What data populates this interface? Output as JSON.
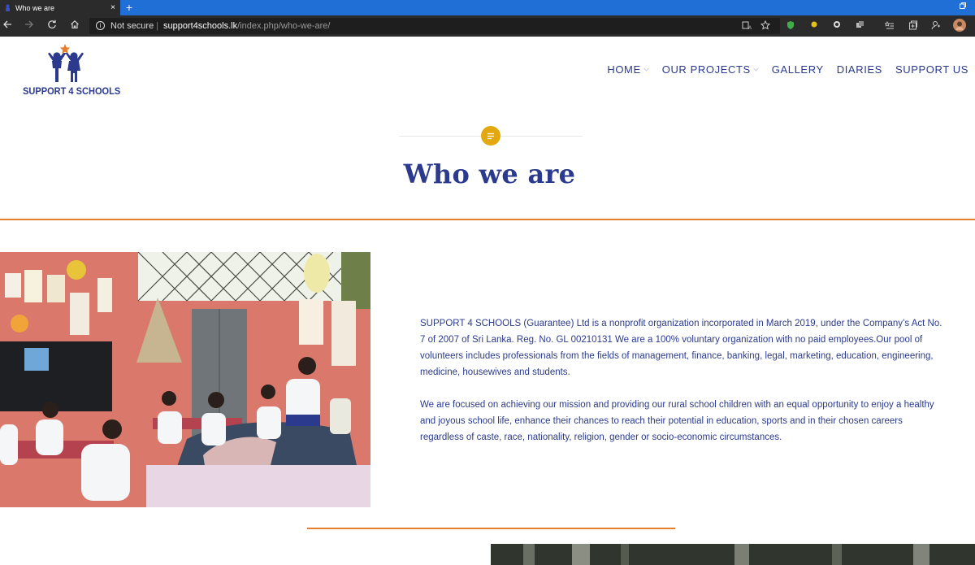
{
  "browser": {
    "tab_title": "Who we are",
    "tab_close": "×",
    "new_tab": "+",
    "security_label": "Not secure",
    "separator": "|",
    "url_host": "support4schools.lk",
    "url_path": "/index.php/who-we-are/"
  },
  "site": {
    "logo_text": "SUPPORT 4 SCHOOLS",
    "nav": [
      {
        "label": "HOME",
        "has_dropdown": true
      },
      {
        "label": "OUR PROJECTS",
        "has_dropdown": true
      },
      {
        "label": "GALLERY",
        "has_dropdown": false
      },
      {
        "label": "DIARIES",
        "has_dropdown": false
      },
      {
        "label": "SUPPORT US",
        "has_dropdown": false
      }
    ]
  },
  "page": {
    "title": "Who we are",
    "paragraphs": [
      "SUPPORT 4 SCHOOLS (Guarantee) Ltd is a nonprofit organization incorporated in March 2019, under the Company’s Act No. 7 of 2007 of Sri Lanka. Reg. No. GL 00210131  We are a 100% voluntary organization with no paid employees.Our pool of volunteers includes professionals from the fields of management, finance, banking, legal, marketing, education, engineering, medicine, housewives and students.",
      "We are focused on achieving our mission and providing our rural school children with an equal opportunity to enjoy a healthy and joyous school life, enhance their chances to reach their potential in education, sports and in their chosen careers regardless of caste, race, nationality, religion, gender or socio-economic circumstances."
    ]
  },
  "colors": {
    "brand_blue": "#2b3a8c",
    "accent_orange": "#e67e2e",
    "accent_yellow": "#e4a80f",
    "browser_blue": "#1f6fd6",
    "browser_dark": "#2b2b2b"
  },
  "icons": [
    "app-favicon",
    "back-arrow-icon",
    "forward-arrow-icon",
    "refresh-icon",
    "home-icon",
    "info-icon",
    "read-aloud-icon",
    "favorite-star-icon",
    "shield-extension-icon",
    "extension-icon",
    "collections-icon",
    "favorites-list-icon",
    "profile-avatar-icon",
    "document-icon",
    "chevron-down-icon"
  ]
}
